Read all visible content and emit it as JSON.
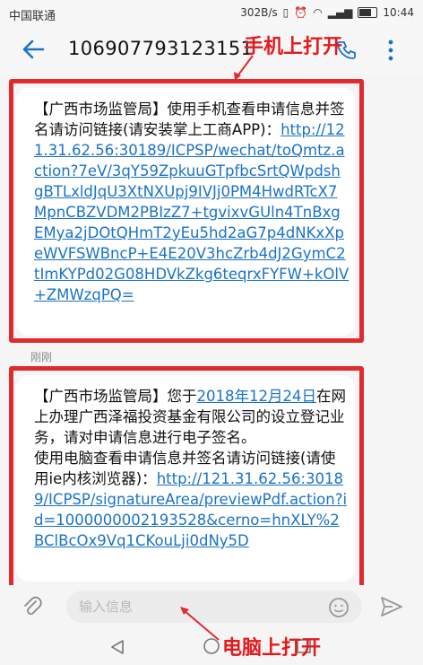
{
  "status_bar": {
    "carrier": "中国联通",
    "net_speed": "302B/s",
    "time": "10:44"
  },
  "header": {
    "phone_number": "106907793123151"
  },
  "annotations": {
    "top_label": "手机上打开",
    "bottom_label": "电脑上打开",
    "color": "#e02b2e"
  },
  "messages": [
    {
      "text": "【广西市场监管局】使用手机查看申请信息并签名请访问链接(请安装掌上工商APP)：",
      "link": "http://121.31.62.56:30189/ICPSP/wechat/toQmtz.action?7eV/3qY59ZpkuuGTpfbcSrtQWpdshgBTLxldJqU3XtNXUpj9IVJj0PM4HwdRTcX7MpnCBZVDM2PBIzZ7+tgvixvGUln4TnBxgEMya2jDOtQHmT2yEu5hd2aG7p4dNKxXpeWVFSWBncP+E4E20V3hcZrb4dJ2GymC2tImKYPd02G08HDVkZkg6teqrxFYFW+kOlV+ZMWzqPQ="
    },
    {
      "text_before_date": "【广西市场监管局】您于",
      "date_link": "2018年12月24日",
      "text_after_date": "在网上办理广西泽福投资基金有限公司的设立登记业务，请对申请信息进行电子签名。",
      "text_second": "使用电脑查看申请信息并签名请访问链接(请使用ie内核浏览器)：",
      "link": "http://121.31.62.56:30189/ICPSP/signatureArea/previewPdf.action?id=1000000002193528&cerno=hnXLY%2BClBcOx9Vq1CKouLji0dNy5D"
    }
  ],
  "timestamp": "刚刚",
  "composer": {
    "placeholder": "输入信息"
  },
  "colors": {
    "link": "#1a73c8",
    "accent": "#1a73c8",
    "annotation": "#e5191c"
  }
}
